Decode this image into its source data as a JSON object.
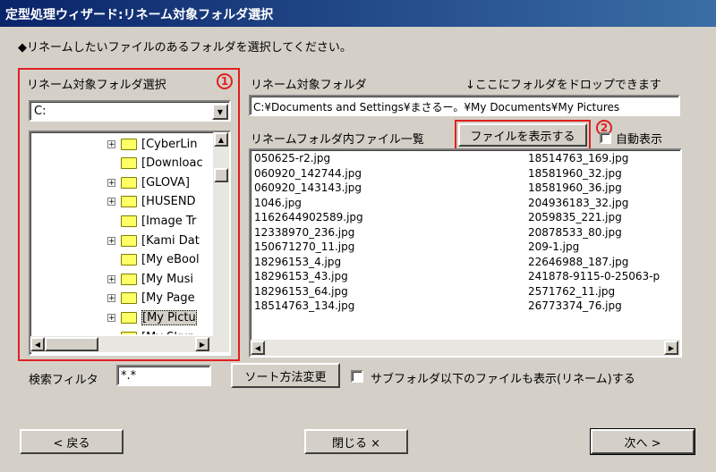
{
  "window": {
    "title": "定型処理ウィザード:リネーム対象フォルダ選択"
  },
  "instruction": "◆リネームしたいファイルのあるフォルダを選択してください。",
  "left_panel": {
    "label": "リネーム対象フォルダ選択",
    "marker": "1",
    "drive_select": "C:",
    "tree_items": [
      {
        "label": "[CyberLin",
        "expandable": true
      },
      {
        "label": "[Downloac",
        "expandable": false
      },
      {
        "label": "[GLOVA]",
        "expandable": true
      },
      {
        "label": "[HUSEND",
        "expandable": true
      },
      {
        "label": "[Image Tr",
        "expandable": false
      },
      {
        "label": "[Kami Dat",
        "expandable": true
      },
      {
        "label": "[My eBool",
        "expandable": false
      },
      {
        "label": "[My Musi",
        "expandable": true
      },
      {
        "label": "[My Page",
        "expandable": true
      },
      {
        "label": "[My Pictu",
        "expandable": true,
        "selected": true
      },
      {
        "label": "[My Skur",
        "expandable": false
      }
    ]
  },
  "right_panel": {
    "target_label": "リネーム対象フォルダ",
    "drop_hint": "↓ここにフォルダをドロップできます",
    "path_value": "C:¥Documents and Settings¥まさるー。¥My Documents¥My Pictures",
    "file_list_label": "リネームフォルダ内ファイル一覧",
    "show_files_button": "ファイルを表示する",
    "marker": "2",
    "auto_display_label": "自動表示",
    "files_col1": [
      "050625-r2.jpg",
      "060920_142744.jpg",
      "060920_143143.jpg",
      "1046.jpg",
      "1162644902589.jpg",
      "12338970_236.jpg",
      "150671270_11.jpg",
      "18296153_4.jpg",
      "18296153_43.jpg",
      "18296153_64.jpg",
      "18514763_134.jpg"
    ],
    "files_col2": [
      "18514763_169.jpg",
      "18581960_32.jpg",
      "18581960_36.jpg",
      "204936183_32.jpg",
      "2059835_221.jpg",
      "20878533_80.jpg",
      "209-1.jpg",
      "22646988_187.jpg",
      "241878-9115-0-25063-p",
      "2571762_11.jpg",
      "26773374_76.jpg"
    ]
  },
  "bottom": {
    "filter_label": "検索フィルタ",
    "filter_value": "*.*",
    "sort_button": "ソート方法変更",
    "subfolder_label": "サブフォルダ以下のファイルも表示(リネーム)する"
  },
  "footer": {
    "back_button": "< 戻る",
    "close_button": "閉じる ×",
    "next_button": "次へ >"
  },
  "colors": {
    "highlight_red": "#e02020",
    "title_bar": "#0a246a",
    "dialog_bg": "#d4d0c8",
    "folder_yellow": "#ffff66"
  }
}
